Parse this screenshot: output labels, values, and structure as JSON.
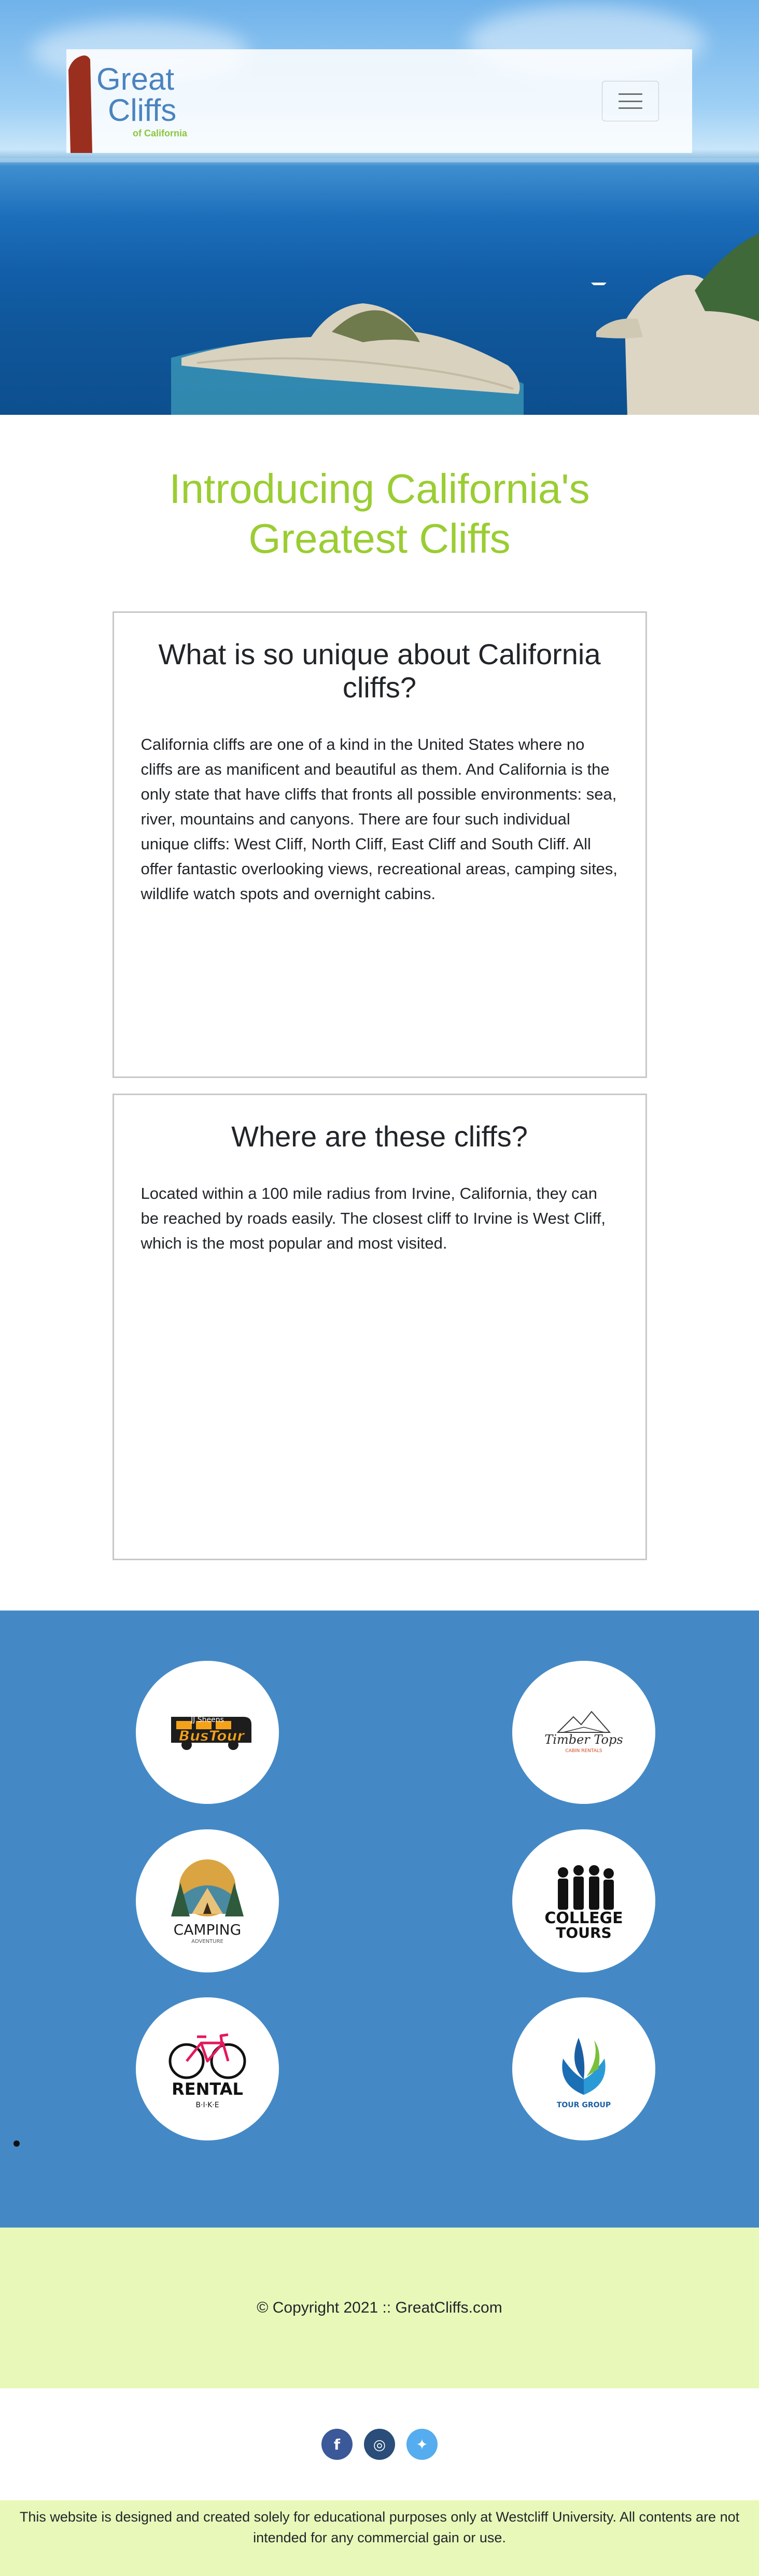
{
  "brand": {
    "line1": "Great",
    "line2": "Cliffs",
    "line3": "of California"
  },
  "nav": {
    "toggle_icon": "hamburger-icon"
  },
  "intro": {
    "title": "Introducing California's Greatest Cliffs"
  },
  "cards": [
    {
      "title": "What is so unique about California cliffs?",
      "body": "California cliffs are one of a kind in the United States where no cliffs are as manificent and beautiful as them. And California is the only state that have cliffs that fronts all possible environments: sea, river, mountains and canyons. There are four such individual unique cliffs: West Cliff, North Cliff, East Cliff and South Cliff. All offer fantastic overlooking views, recreational areas, camping sites, wildlife watch spots and overnight cabins."
    },
    {
      "title": "Where are these cliffs?",
      "body": "Located within a 100 mile radius from Irvine, California, they can be reached by roads easily. The closest cliff to Irvine is West Cliff, which is the most popular and most visited."
    }
  ],
  "partners": [
    {
      "name": "bus-tour-logo",
      "line1": "JJ Sheens",
      "line2": "BusTour"
    },
    {
      "name": "timber-tops-logo",
      "line1": "Timber Tops",
      "line2": "CABIN RENTALS"
    },
    {
      "name": "camping-logo",
      "line1": "CAMPING",
      "line2": "ADVENTURE"
    },
    {
      "name": "college-tours-logo",
      "line1": "COLLEGE",
      "line2": "TOURS"
    },
    {
      "name": "rental-bike-logo",
      "line1": "RENTAL",
      "line2": "B·I·K·E"
    },
    {
      "name": "tour-group-logo",
      "line1": "TOUR GROUP",
      "line2": ""
    }
  ],
  "footer": {
    "copyright": "© Copyright 2021 :: GreatCliffs.com",
    "social": {
      "facebook": "f",
      "instagram": "◎",
      "twitter": "✦"
    },
    "disclaimer": "This website is designed and created solely for educational purposes only at Westcliff University. All contents are not intended for any commercial gain or use."
  },
  "colors": {
    "accent_green": "#9acd32",
    "brand_blue": "#4a84bf",
    "partners_bg": "#4489c6",
    "footer_bg": "#e8f8b9"
  }
}
